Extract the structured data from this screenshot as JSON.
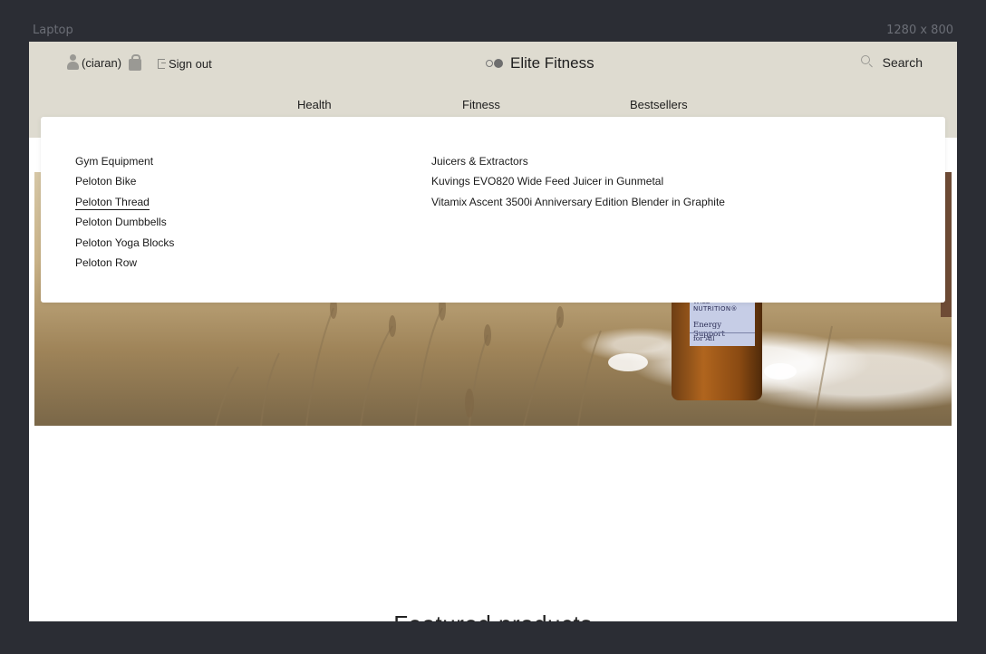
{
  "device": {
    "name": "Laptop",
    "resolution": "1280 x 800"
  },
  "header": {
    "username": "(ciaran)",
    "signout_label": "Sign out",
    "brand_name": "Elite Fitness",
    "search_label": "Search"
  },
  "nav": {
    "items": [
      {
        "label": "Health"
      },
      {
        "label": "Fitness"
      },
      {
        "label": "Bestsellers"
      }
    ]
  },
  "dropdown": {
    "columns": [
      {
        "items": [
          {
            "label": "Gym Equipment"
          },
          {
            "label": "Peloton Bike"
          },
          {
            "label": "Peloton Thread",
            "active": true
          },
          {
            "label": "Peloton Dumbbells"
          },
          {
            "label": "Peloton Yoga Blocks"
          },
          {
            "label": "Peloton Row"
          }
        ]
      },
      {
        "items": [
          {
            "label": "Juicers & Extractors"
          },
          {
            "label": "Kuvings EVO820 Wide Feed Juicer in Gunmetal"
          },
          {
            "label": "Vitamix Ascent 3500i Anniversary Edition Blender in Graphite"
          }
        ]
      }
    ]
  },
  "hero": {
    "product_brand": "WILD NUTRITION®",
    "product_name": "Energy Support",
    "product_sub": "for All"
  },
  "featured": {
    "heading": "Featured products"
  },
  "colors": {
    "header_bg": "#dedbd0",
    "frame_bg": "#2b2d34"
  }
}
